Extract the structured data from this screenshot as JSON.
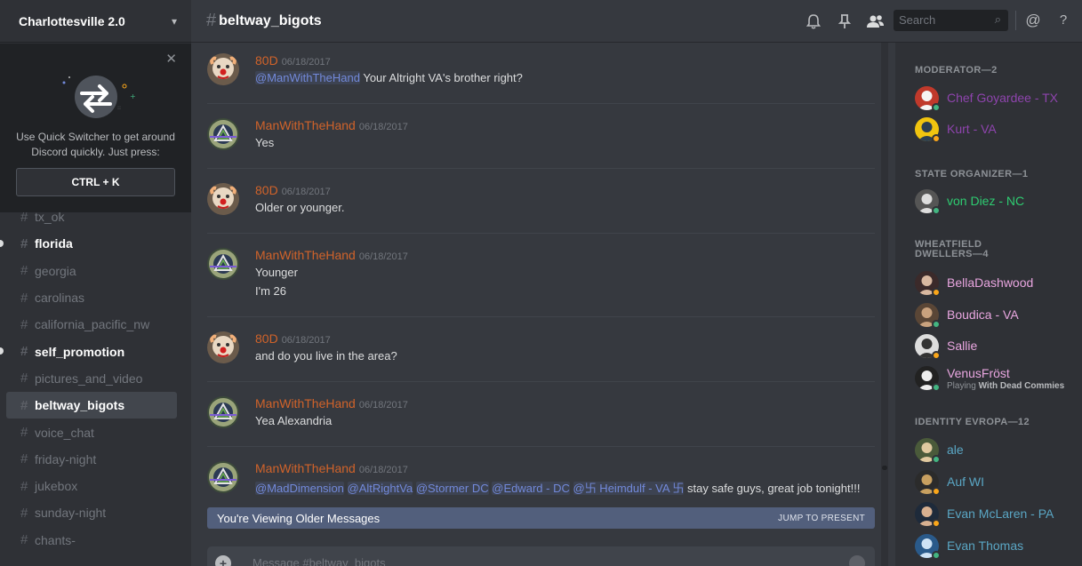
{
  "guild": {
    "name": "Charlottesville 2.0"
  },
  "quick_switcher": {
    "tip": "Use Quick Switcher to get around Discord quickly. Just press:",
    "shortcut": "CTRL + K"
  },
  "channels": [
    {
      "name": "tx_ok",
      "state": "normal"
    },
    {
      "name": "florida",
      "state": "unread"
    },
    {
      "name": "georgia",
      "state": "normal"
    },
    {
      "name": "carolinas",
      "state": "normal"
    },
    {
      "name": "california_pacific_nw",
      "state": "normal"
    },
    {
      "name": "self_promotion",
      "state": "unread"
    },
    {
      "name": "pictures_and_video",
      "state": "normal"
    },
    {
      "name": "beltway_bigots",
      "state": "selected"
    },
    {
      "name": "voice_chat",
      "state": "normal"
    },
    {
      "name": "friday-night",
      "state": "normal"
    },
    {
      "name": "jukebox",
      "state": "normal"
    },
    {
      "name": "sunday-night",
      "state": "normal"
    },
    {
      "name": "chants-",
      "state": "normal"
    }
  ],
  "header": {
    "hash": "#",
    "channel_name": "beltway_bigots",
    "search_placeholder": "Search",
    "icons": [
      "bell-icon",
      "pin-icon",
      "members-icon",
      "mention-icon",
      "help-icon"
    ]
  },
  "messages": [
    {
      "author": "80D",
      "timestamp": "06/18/2017",
      "avatar": "clown",
      "lines": [
        [
          {
            "t": "@ManWithTheHand",
            "m": true
          },
          {
            "t": " Your Altright VA's brother right?",
            "m": false
          }
        ]
      ]
    },
    {
      "author": "ManWithTheHand",
      "timestamp": "06/18/2017",
      "avatar": "emblem",
      "lines": [
        [
          {
            "t": "Yes",
            "m": false
          }
        ]
      ]
    },
    {
      "author": "80D",
      "timestamp": "06/18/2017",
      "avatar": "clown",
      "lines": [
        [
          {
            "t": "Older or younger.",
            "m": false
          }
        ]
      ]
    },
    {
      "author": "ManWithTheHand",
      "timestamp": "06/18/2017",
      "avatar": "emblem",
      "lines": [
        [
          {
            "t": "Younger",
            "m": false
          }
        ],
        [
          {
            "t": "I'm 26",
            "m": false
          }
        ]
      ]
    },
    {
      "author": "80D",
      "timestamp": "06/18/2017",
      "avatar": "clown",
      "lines": [
        [
          {
            "t": "and do you live in the area?",
            "m": false
          }
        ]
      ]
    },
    {
      "author": "ManWithTheHand",
      "timestamp": "06/18/2017",
      "avatar": "emblem",
      "lines": [
        [
          {
            "t": "Yea Alexandria",
            "m": false
          }
        ]
      ]
    },
    {
      "author": "ManWithTheHand",
      "timestamp": "06/18/2017",
      "avatar": "emblem",
      "lines": [
        [
          {
            "t": "@MadDimension",
            "m": true
          },
          {
            "t": " ",
            "m": false
          },
          {
            "t": "@AltRightVa",
            "m": true
          },
          {
            "t": " ",
            "m": false
          },
          {
            "t": "@Stormer DC",
            "m": true
          },
          {
            "t": " ",
            "m": false
          },
          {
            "t": "@Edward - DC",
            "m": true
          },
          {
            "t": " ",
            "m": false
          },
          {
            "t": "@卐 Heimdulf - VA 卐",
            "m": true
          },
          {
            "t": "  stay safe guys, great job tonight!!!",
            "m": false
          }
        ]
      ]
    }
  ],
  "older_bar": {
    "label": "You're Viewing Older Messages",
    "jump": "JUMP TO PRESENT"
  },
  "composer": {
    "placeholder": "Message #beltway_bigots"
  },
  "member_groups": [
    {
      "role": "MODERATOR—2",
      "members": [
        {
          "name": "Chef Goyardee - TX",
          "color": "#8e44ad",
          "status": "online",
          "activity": ""
        },
        {
          "name": "Kurt - VA",
          "color": "#8e44ad",
          "status": "idle",
          "activity": ""
        }
      ]
    },
    {
      "role": "STATE ORGANIZER—1",
      "members": [
        {
          "name": "von Diez - NC",
          "color": "#2ecc71",
          "status": "online",
          "activity": ""
        }
      ]
    },
    {
      "role": "WHEATFIELD DWELLERS—4",
      "members": [
        {
          "name": "BellaDashwood",
          "color": "#e9a6e0",
          "status": "idle",
          "activity": ""
        },
        {
          "name": "Boudica - VA",
          "color": "#e9a6e0",
          "status": "online",
          "activity": ""
        },
        {
          "name": "Sallie",
          "color": "#e9a6e0",
          "status": "idle",
          "activity": ""
        },
        {
          "name": "VenusFröst",
          "color": "#e9a6e0",
          "status": "online",
          "activity_prefix": "Playing ",
          "activity": "With Dead Commies"
        }
      ]
    },
    {
      "role": "IDENTITY EVROPA—12",
      "members": [
        {
          "name": "ale",
          "color": "#5aa6c4",
          "status": "online",
          "activity": ""
        },
        {
          "name": "Auf WI",
          "color": "#5aa6c4",
          "status": "idle",
          "activity": ""
        },
        {
          "name": "Evan McLaren - PA",
          "color": "#5aa6c4",
          "status": "idle",
          "activity": ""
        },
        {
          "name": "Evan Thomas",
          "color": "#5aa6c4",
          "status": "online",
          "activity": ""
        }
      ]
    }
  ],
  "status_colors": {
    "online": "#43b581",
    "idle": "#faa61a"
  }
}
